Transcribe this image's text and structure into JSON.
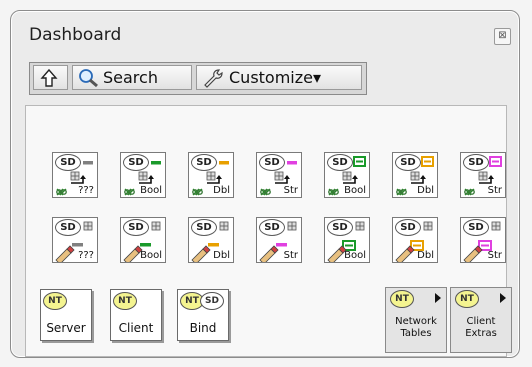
{
  "window": {
    "title": "Dashboard",
    "close_glyph": "⊠"
  },
  "toolbar": {
    "search_label": "Search",
    "customize_label": "Customize▾"
  },
  "colors": {
    "any": "#808080",
    "bool": "#1a9a2a",
    "dbl": "#e8a000",
    "str": "#e040e0"
  },
  "read_row": [
    {
      "name": "sd-read-any",
      "label": "???",
      "color": "#808080",
      "style": "bar"
    },
    {
      "name": "sd-read-bool",
      "label": "Bool",
      "color": "#1a9a2a",
      "style": "bar"
    },
    {
      "name": "sd-read-dbl",
      "label": "Dbl",
      "color": "#e8a000",
      "style": "bar"
    },
    {
      "name": "sd-read-str",
      "label": "Str",
      "color": "#e040e0",
      "style": "bar"
    },
    {
      "name": "sd-read-bool-array",
      "label": "Bool",
      "color": "#1a9a2a",
      "style": "array"
    },
    {
      "name": "sd-read-dbl-array",
      "label": "Dbl",
      "color": "#e8a000",
      "style": "array"
    },
    {
      "name": "sd-read-str-array",
      "label": "Str",
      "color": "#e040e0",
      "style": "array"
    }
  ],
  "write_row": [
    {
      "name": "sd-write-any",
      "label": "???",
      "color": "#808080",
      "style": "bar"
    },
    {
      "name": "sd-write-bool",
      "label": "Bool",
      "color": "#1a9a2a",
      "style": "bar"
    },
    {
      "name": "sd-write-dbl",
      "label": "Dbl",
      "color": "#e8a000",
      "style": "bar"
    },
    {
      "name": "sd-write-str",
      "label": "Str",
      "color": "#e040e0",
      "style": "bar"
    },
    {
      "name": "sd-write-bool-array",
      "label": "Bool",
      "color": "#1a9a2a",
      "style": "array"
    },
    {
      "name": "sd-write-dbl-array",
      "label": "Dbl",
      "color": "#e8a000",
      "style": "array"
    },
    {
      "name": "sd-write-str-array",
      "label": "Str",
      "color": "#e040e0",
      "style": "array"
    }
  ],
  "nt_items": [
    {
      "label": "Server"
    },
    {
      "label": "Client"
    },
    {
      "label": "Bind"
    }
  ],
  "badges": {
    "sd": "SD",
    "nt": "NT"
  },
  "subpalettes": [
    {
      "line1": "Network",
      "line2": "Tables"
    },
    {
      "line1": "Client",
      "line2": "Extras"
    }
  ]
}
